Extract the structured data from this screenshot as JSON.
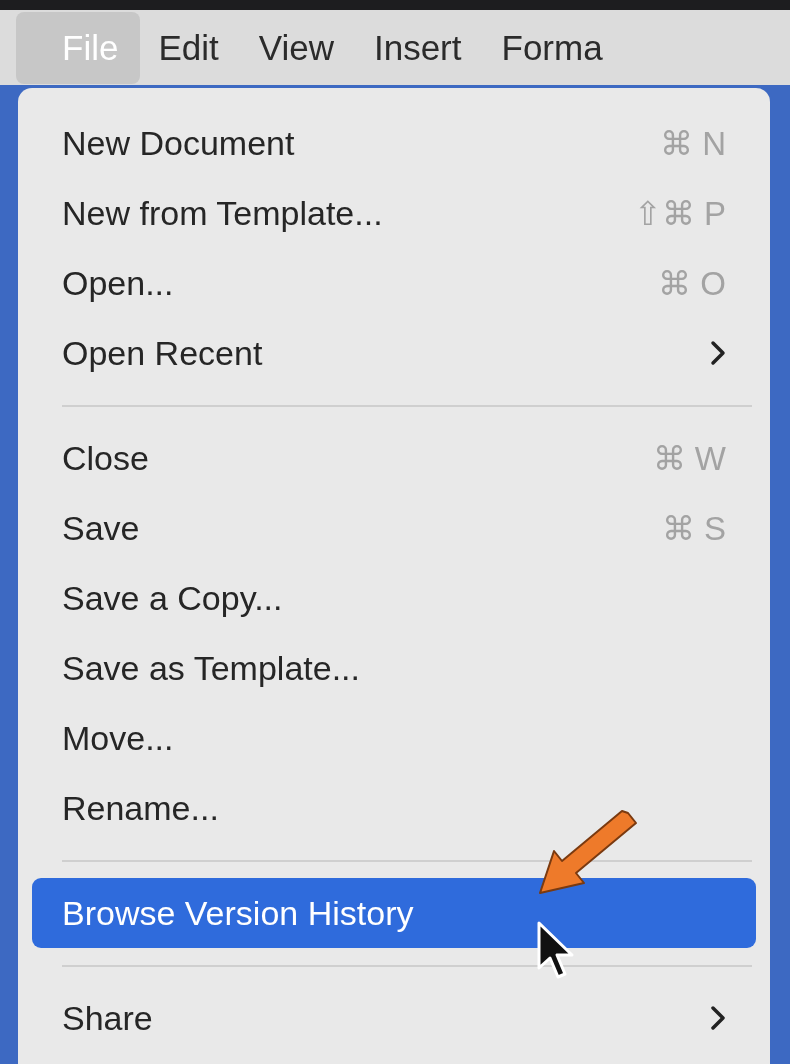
{
  "menu_bar": [
    {
      "label": "File",
      "selected": true
    },
    {
      "label": "Edit",
      "selected": false
    },
    {
      "label": "View",
      "selected": false
    },
    {
      "label": "Insert",
      "selected": false
    },
    {
      "label": "Forma",
      "selected": false
    }
  ],
  "menu": {
    "items": [
      {
        "kind": "item",
        "label": "New Document",
        "shortcut": "⌘ N",
        "selected": false
      },
      {
        "kind": "item",
        "label": "New from Template...",
        "shortcut": "⇧⌘ P",
        "selected": false
      },
      {
        "kind": "item",
        "label": "Open...",
        "shortcut": "⌘ O",
        "selected": false
      },
      {
        "kind": "item",
        "label": "Open Recent",
        "submenu": true,
        "selected": false
      },
      {
        "kind": "separator"
      },
      {
        "kind": "item",
        "label": "Close",
        "shortcut": "⌘ W",
        "selected": false
      },
      {
        "kind": "item",
        "label": "Save",
        "shortcut": "⌘ S",
        "selected": false
      },
      {
        "kind": "item",
        "label": "Save a Copy...",
        "selected": false
      },
      {
        "kind": "item",
        "label": "Save as Template...",
        "selected": false
      },
      {
        "kind": "item",
        "label": "Move...",
        "selected": false
      },
      {
        "kind": "item",
        "label": "Rename...",
        "selected": false
      },
      {
        "kind": "separator"
      },
      {
        "kind": "item",
        "label": "Browse Version History",
        "selected": true
      },
      {
        "kind": "separator"
      },
      {
        "kind": "item",
        "label": "Share",
        "submenu": true,
        "selected": false
      }
    ]
  }
}
